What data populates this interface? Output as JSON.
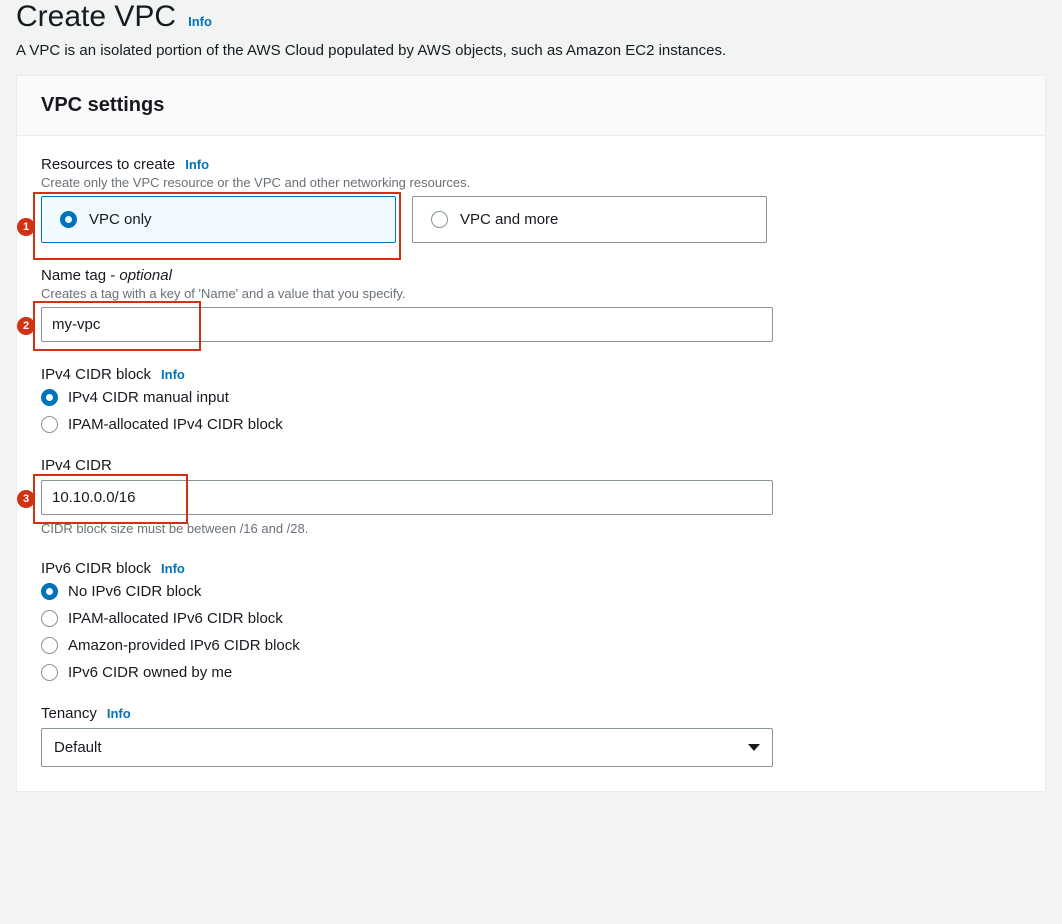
{
  "header": {
    "title": "Create VPC",
    "info": "Info",
    "description": "A VPC is an isolated portion of the AWS Cloud populated by AWS objects, such as Amazon EC2 instances."
  },
  "panel": {
    "title": "VPC settings"
  },
  "resources": {
    "label": "Resources to create",
    "info": "Info",
    "hint": "Create only the VPC resource or the VPC and other networking resources.",
    "option_vpc_only": "VPC only",
    "option_vpc_and_more": "VPC and more"
  },
  "name_tag": {
    "label": "Name tag - ",
    "label_suffix": "optional",
    "hint": "Creates a tag with a key of 'Name' and a value that you specify.",
    "value": "my-vpc"
  },
  "ipv4_block": {
    "label": "IPv4 CIDR block",
    "info": "Info",
    "option_manual": "IPv4 CIDR manual input",
    "option_ipam": "IPAM-allocated IPv4 CIDR block"
  },
  "ipv4_cidr": {
    "label": "IPv4 CIDR",
    "value": "10.10.0.0/16",
    "hint": "CIDR block size must be between /16 and /28."
  },
  "ipv6_block": {
    "label": "IPv6 CIDR block",
    "info": "Info",
    "option_none": "No IPv6 CIDR block",
    "option_ipam": "IPAM-allocated IPv6 CIDR block",
    "option_amazon": "Amazon-provided IPv6 CIDR block",
    "option_owned": "IPv6 CIDR owned by me"
  },
  "tenancy": {
    "label": "Tenancy",
    "info": "Info",
    "value": "Default"
  },
  "annotations": {
    "a1": "1",
    "a2": "2",
    "a3": "3"
  }
}
